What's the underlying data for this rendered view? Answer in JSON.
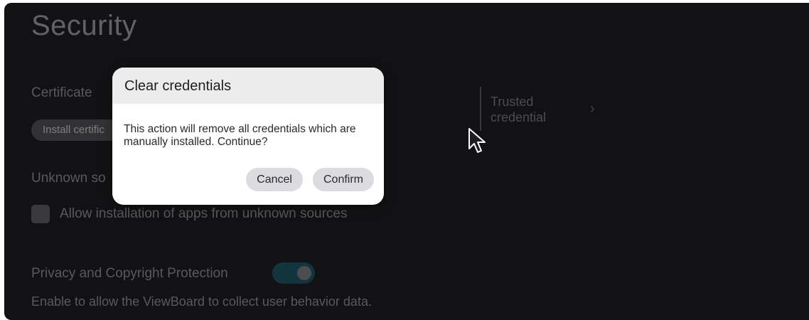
{
  "page": {
    "title": "Security"
  },
  "certificate": {
    "label": "Certificate",
    "install_button": "Install certific"
  },
  "unknown_sources": {
    "label": "Unknown so",
    "checkbox_label": "Allow installation of apps from unknown sources",
    "checked": false
  },
  "privacy": {
    "label": "Privacy and Copyright Protection",
    "toggle_on": true,
    "description": "Enable to allow the ViewBoard to collect user behavior data."
  },
  "trusted": {
    "line1": "Trusted",
    "line2": "credential",
    "chevron": "›"
  },
  "dialog": {
    "title": "Clear credentials",
    "message": "This action will remove all credentials which are manually installed. Continue?",
    "cancel_label": "Cancel",
    "confirm_label": "Confirm"
  },
  "icons": {
    "cursor": "mouse-pointer-icon",
    "chevron": "chevron-right-icon"
  },
  "colors": {
    "background": "#222226",
    "toggle_track": "#1f5f6f",
    "dialog_header": "#ececec",
    "dialog_button": "#dcdce0"
  }
}
